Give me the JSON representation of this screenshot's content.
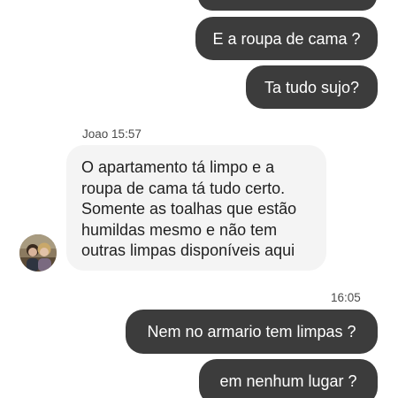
{
  "messages_out_top": [
    {
      "text": "E a roupa de cama ?"
    },
    {
      "text": "Ta tudo sujo?"
    }
  ],
  "incoming": {
    "sender": "Joao",
    "time": "15:57",
    "lines": [
      "O apartamento tá limpo e a",
      "roupa de cama tá tudo certo.",
      "Somente as toalhas que estão",
      "humildas mesmo e não tem",
      "outras limpas disponíveis aqui"
    ],
    "avatar_icon": "user-avatar-icon"
  },
  "outgoing_time": "16:05",
  "messages_out_bottom": [
    {
      "text": "Nem no armario tem limpas ?"
    },
    {
      "text": "em nenhum lugar ?"
    }
  ],
  "colors": {
    "outgoing_bubble": "#3c3c3c",
    "incoming_bubble": "#f4f4f4",
    "background": "#ffffff"
  }
}
